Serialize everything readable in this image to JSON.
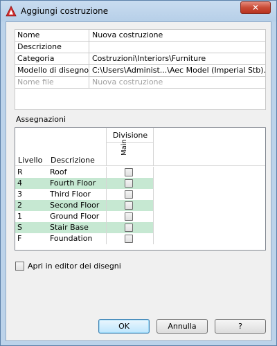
{
  "window": {
    "title": "Aggiungi costruzione",
    "close_label": "✕"
  },
  "properties": [
    {
      "name": "Nome",
      "value": "Nuova costruzione",
      "disabled": false
    },
    {
      "name": "Descrizione",
      "value": "",
      "disabled": false
    },
    {
      "name": "Categoria",
      "value": "Costruzioni\\Interiors\\Furniture",
      "disabled": false
    },
    {
      "name": "Modello di disegno",
      "value": "C:\\Users\\Administ...\\Aec Model (Imperial Stb).dwt",
      "disabled": false
    },
    {
      "name": "Nome file",
      "value": "Nuova costruzione",
      "disabled": true
    }
  ],
  "assignments": {
    "label": "Assegnazioni",
    "headers": {
      "level": "Livello",
      "description": "Descrizione",
      "division": "Divisione",
      "main": "Main"
    },
    "rows": [
      {
        "level": "R",
        "description": "Roof",
        "highlight": false,
        "checked": false
      },
      {
        "level": "4",
        "description": "Fourth Floor",
        "highlight": true,
        "checked": false
      },
      {
        "level": "3",
        "description": "Third Floor",
        "highlight": false,
        "checked": false
      },
      {
        "level": "2",
        "description": "Second Floor",
        "highlight": true,
        "checked": false
      },
      {
        "level": "1",
        "description": "Ground Floor",
        "highlight": false,
        "checked": false
      },
      {
        "level": "S",
        "description": "Stair Base",
        "highlight": true,
        "checked": false
      },
      {
        "level": "F",
        "description": "Foundation",
        "highlight": false,
        "checked": false
      }
    ]
  },
  "options": {
    "open_in_editor_label": "Apri in editor dei disegni",
    "open_in_editor_checked": false
  },
  "buttons": {
    "ok": "OK",
    "cancel": "Annulla",
    "help": "?"
  },
  "colors": {
    "highlight_row": "#c6e8d2",
    "title_bar": "#bcd3ea",
    "close_button": "#c94b36",
    "app_icon": "#d32f2f"
  }
}
